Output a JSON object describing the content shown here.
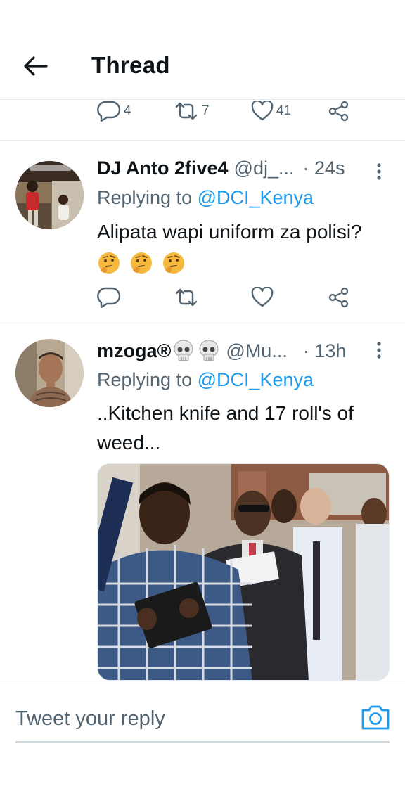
{
  "header": {
    "title": "Thread"
  },
  "previous_tweet_actions": {
    "reply_count": "4",
    "retweet_count": "7",
    "like_count": "41"
  },
  "tweets": [
    {
      "name": "DJ Anto 2five4",
      "handle": "@dj_...",
      "time": "· 24s",
      "replying_prefix": "Replying to ",
      "replying_to": "@DCI_Kenya",
      "text": "Alipata wapi uniform za polisi?",
      "emojis": [
        "thinking-face",
        "thinking-face",
        "thinking-face"
      ]
    },
    {
      "name": "mzoga®",
      "name_emojis": [
        "skull",
        "skull"
      ],
      "handle": "@Mu...",
      "time": "· 13h",
      "replying_prefix": "Replying to ",
      "replying_to": "@DCI_Kenya",
      "text": "..Kitchen knife and 17 roll's of weed..."
    }
  ],
  "reply_bar": {
    "placeholder": "Tweet your reply"
  },
  "colors": {
    "accent": "#1d9bf0",
    "secondary_text": "#536471",
    "divider": "#e6ecf0"
  }
}
